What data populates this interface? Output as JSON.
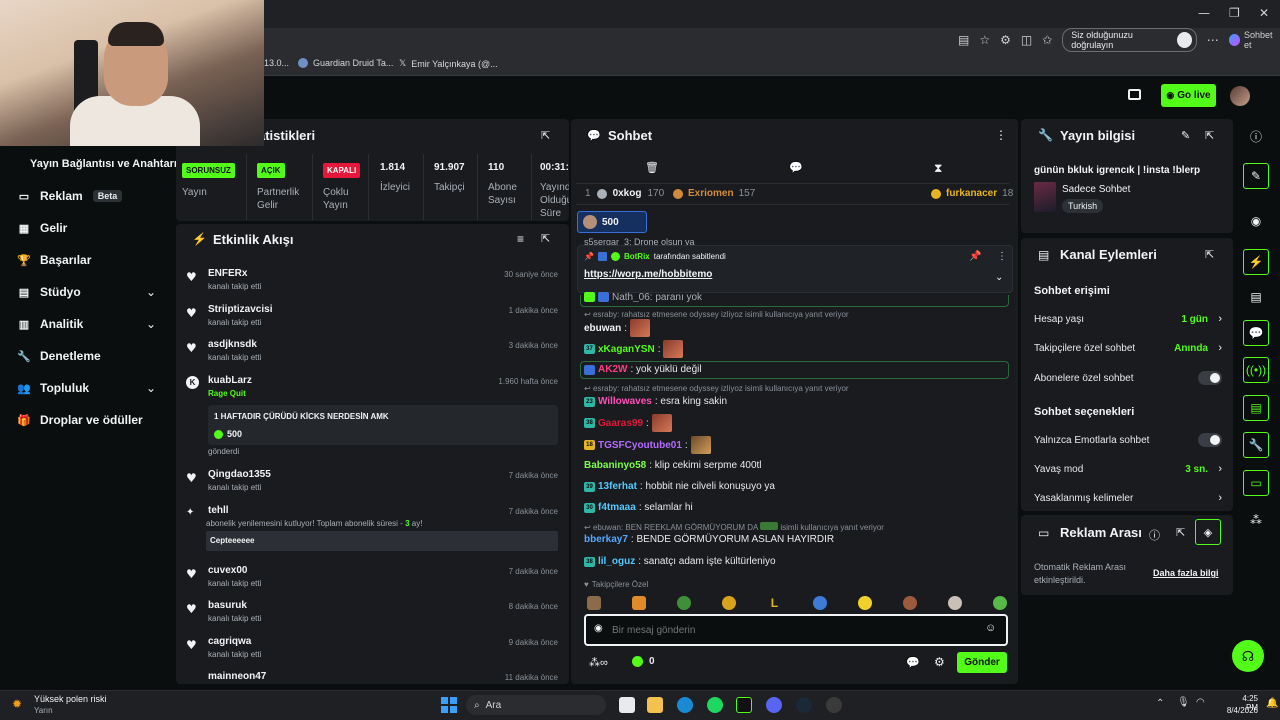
{
  "browser": {
    "window_controls": [
      "—",
      "❐",
      "✕"
    ],
    "verify_label": "Siz olduğunuzu doğrulayın",
    "chat_button": "Sohbet et",
    "bookmarks": [
      "13.0...",
      "Guardian Druid Ta...",
      "Emir Yalçınkaya (@..."
    ]
  },
  "topbar": {
    "go_live": "Go live"
  },
  "nav": {
    "header": "Yayın Bağlantısı ve Anahtarı",
    "items": [
      {
        "label": "Reklam",
        "badge": "Beta"
      },
      {
        "label": "Gelir"
      },
      {
        "label": "Başarılar"
      },
      {
        "label": "Stüdyo"
      },
      {
        "label": "Analitik"
      },
      {
        "label": "Denetleme"
      },
      {
        "label": "Topluluk"
      },
      {
        "label": "Droplar ve ödüller"
      }
    ]
  },
  "stats": {
    "title": "atistikleri",
    "cells": [
      {
        "badge": "SORUNSUZ",
        "label": "Yayın"
      },
      {
        "badge": "AÇIK",
        "label": "Partnerlik Gelir"
      },
      {
        "badge": "KAPALI",
        "label": "Çoklu Yayın"
      },
      {
        "value": "1.814",
        "label": "İzleyici"
      },
      {
        "value": "91.907",
        "label": "Takipçi"
      },
      {
        "value": "110",
        "label": "Abone Sayısı"
      },
      {
        "value": "00:31:",
        "label": "Yayında Olduğu Süre"
      }
    ],
    "colors": {
      "sorunsuz": "#53fc18",
      "acik": "#53fc18",
      "kapali": "#e5173a"
    }
  },
  "feed": {
    "title": "Etkinlik Akışı",
    "items": [
      {
        "name": "ENFERx",
        "sub": "kanalı takip etti",
        "time": "30 saniye önce"
      },
      {
        "name": "Striiptizavcisi",
        "sub": "kanalı takip etti",
        "time": "1 dakika önce"
      },
      {
        "name": "asdjknsdk",
        "sub": "kanalı takip etti",
        "time": "3 dakika önce"
      },
      {
        "name": "kuabLarz",
        "sub": "Rage Quit",
        "time": "1.960 hafta önce",
        "message": "1 HAFTADIR ÇÜRÜDÜ KİCKS NERDESİN AMK",
        "amount": "500",
        "footer": "gönderdi"
      },
      {
        "name": "Qingdao1355",
        "sub": "kanalı takip etti",
        "time": "7 dakika önce"
      },
      {
        "name": "tehll",
        "sub": "abonelik yenilemesini kutluyor! Toplam abonelik süresi - 3 ay!",
        "sub_prefix": "abonelik yenilemesini kutluyor! Toplam abonelik süresi -",
        "sub_months": "3",
        "sub_suffix": "ay!",
        "time": "7 dakika önce",
        "message": "Cepteeeeee"
      },
      {
        "name": "cuvex00",
        "sub": "kanalı takip etti",
        "time": "7 dakika önce"
      },
      {
        "name": "basuruk",
        "sub": "kanalı takip etti",
        "time": "8 dakika önce"
      },
      {
        "name": "cagriqwa",
        "sub": "kanalı takip etti",
        "time": "9 dakika önce"
      },
      {
        "name": "mainneon47",
        "time": "11 dakika önce"
      }
    ]
  },
  "chat": {
    "title": "Sohbet",
    "leaderboard": [
      {
        "rank": "1",
        "name": "0xkog",
        "score": "170"
      },
      {
        "name": "Exriomen",
        "score": "157"
      },
      {
        "name": "furkanacer",
        "score": "18"
      }
    ],
    "gift_count": "500",
    "pinned": {
      "author": "BotRix",
      "action": "tarafından sabitlendi",
      "link": "https://worp.me/hobbitemo"
    },
    "partial_top": "s5sergar_3: Drone olsun ya",
    "partial_second": "Nath_06: paranı yok",
    "messages": [
      {
        "reply": "esraby: rahatsız etmesene odyssey izliyoz isimli kullanıcıya yanıt veriyor"
      },
      {
        "user": "ebuwan",
        "text": ":",
        "emote": true
      },
      {
        "user": "xKaganYSN",
        "text": ":",
        "emote": true,
        "badge": "37"
      },
      {
        "user": "AK2W",
        "text": ": yok yüklü değil",
        "highlight": true
      },
      {
        "reply": "esraby: rahatsız etmesene odyssey izliyoz isimli kullanıcıya yanıt veriyor"
      },
      {
        "user": "Willowaves",
        "text": ": esra king sakin",
        "badge": "23"
      },
      {
        "user": "Gaaras99",
        "text": ":",
        "emote": true,
        "badge": "38"
      },
      {
        "user": "TGSFCyoutube01",
        "text": ":",
        "emote": true,
        "badge": "18"
      },
      {
        "user": "Babaninyo58",
        "text": ": klip cekimi serpme 400tl"
      },
      {
        "user": "13ferhat",
        "text": ": hobbit nie cilveli konuşuyo ya",
        "badge": "39"
      },
      {
        "user": "f4tmaaa",
        "text": ": selamlar hi",
        "badge": "30"
      },
      {
        "reply_prefix": "ebuwan: BEN REEKLAM GÖRMÜYORUM DA",
        "reply_suffix": "isimli kullanıcıya yanıt veriyor"
      },
      {
        "user": "bberkay7",
        "text": ": BENDE GÖRMÜYORUM ASLAN HAYIRDIR"
      },
      {
        "user": "lil_oguz",
        "text": ": sanatçı adam işte kültürleniyo",
        "badge": "38"
      }
    ],
    "followers_only": "Takipçilere Özel",
    "input_placeholder": "Bir mesaj gönderin",
    "points": "0",
    "send": "Gönder"
  },
  "stream_info": {
    "title": "Yayın bilgisi",
    "stream_title": "günün bkluk igrencık | !insta !blerp",
    "category": "Sadece Sohbet",
    "tag": "Turkish"
  },
  "channel_actions": {
    "title": "Kanal Eylemleri",
    "access_title": "Sohbet erişimi",
    "rows1": [
      {
        "label": "Hesap yaşı",
        "value": "1 gün"
      },
      {
        "label": "Takipçilere özel sohbet",
        "value": "Anında"
      },
      {
        "label": "Abonelere özel sohbet",
        "switch": true
      }
    ],
    "options_title": "Sohbet seçenekleri",
    "rows2": [
      {
        "label": "Yalnızca Emotlarla sohbet",
        "switch": true
      },
      {
        "label": "Yavaş mod",
        "value": "3 sn."
      },
      {
        "label": "Yasaklanmış kelimeler"
      }
    ]
  },
  "ad_break": {
    "title": "Reklam Arası",
    "desc": "Otomatik Reklam Arası etkinleştirildi.",
    "link": "Daha fazla bilgi"
  },
  "taskbar": {
    "weather_title": "Yüksek polen riski",
    "weather_sub": "Yarın",
    "search": "Ara",
    "time": "4:25 PM",
    "date": "8/4/2026"
  }
}
